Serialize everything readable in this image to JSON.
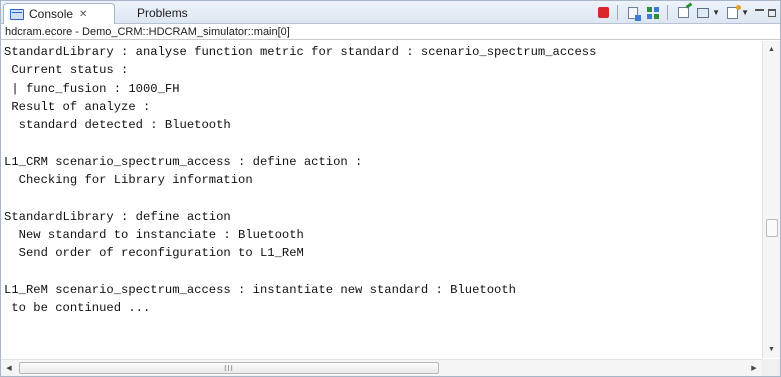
{
  "tabs": [
    {
      "label": "Console",
      "close_glyph": "✕",
      "icon": "console-icon",
      "active": true
    },
    {
      "label": "Problems",
      "active": false
    }
  ],
  "toolbar": {
    "icons": [
      "terminate-icon",
      "remove-launch-icon",
      "remove-all-terminated-icon",
      "pin-console-icon",
      "display-selected-console-icon",
      "open-console-icon",
      "minimize-icon",
      "maximize-icon"
    ],
    "terminate_color": "#d8262a"
  },
  "console_path": "hdcram.ecore - Demo_CRM::HDCRAM_simulator::main[0]",
  "console_lines": [
    "StandardLibrary : analyse function metric for standard : scenario_spectrum_access",
    " Current status :",
    " | func_fusion : 1000_FH",
    " Result of analyze :",
    "  standard detected : Bluetooth",
    "",
    "L1_CRM scenario_spectrum_access : define action :",
    "  Checking for Library information",
    "",
    "StandardLibrary : define action",
    "  New standard to instanciate : Bluetooth",
    "  Send order of reconfiguration to L1_ReM",
    "",
    "L1_ReM scenario_spectrum_access : instantiate new standard : Bluetooth",
    " to be continued ..."
  ],
  "scrollbars": {
    "vertical": {
      "up_glyph": "▲",
      "down_glyph": "▼"
    },
    "horizontal": {
      "left_glyph": "◀",
      "right_glyph": "▶",
      "thumb_grip": "III"
    }
  }
}
